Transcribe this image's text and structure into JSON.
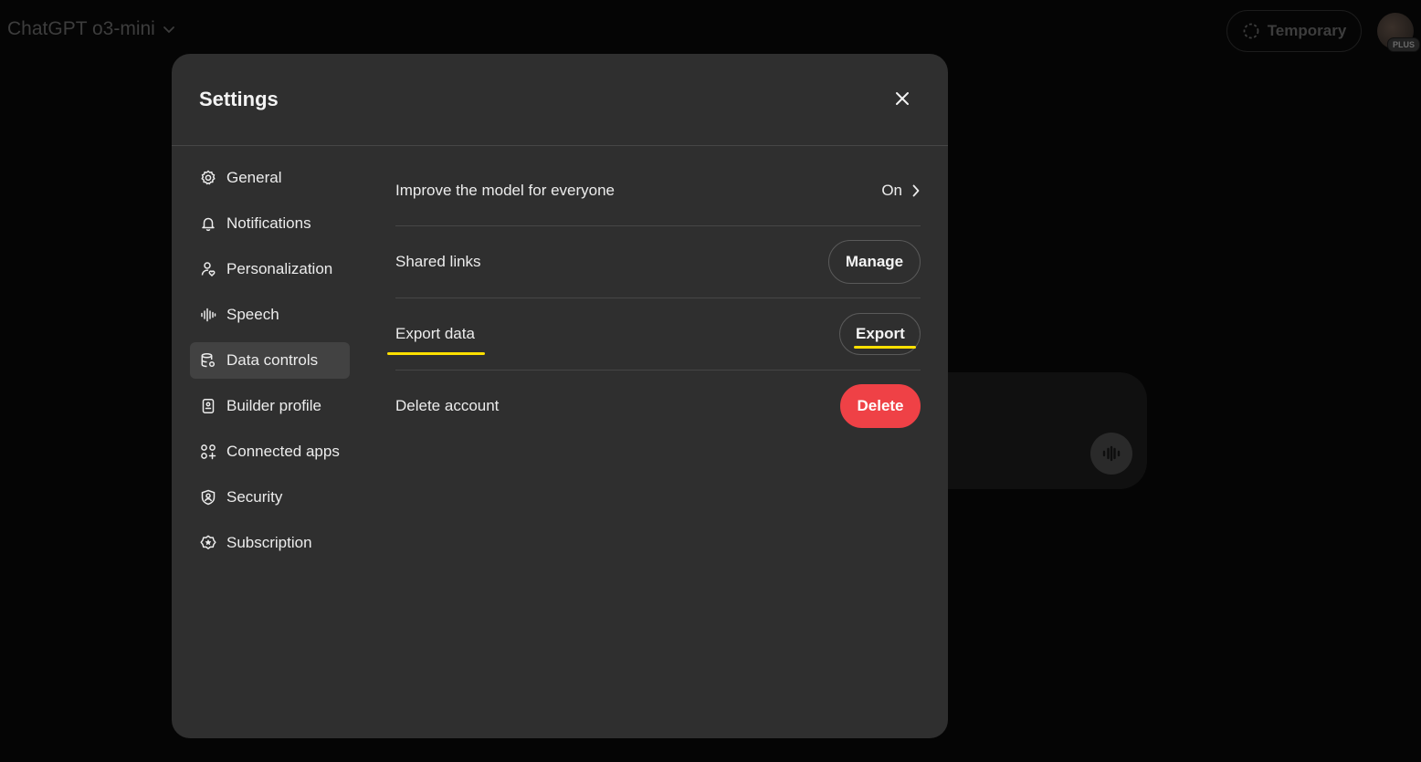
{
  "topbar": {
    "model_name": "ChatGPT o3-mini",
    "temporary_label": "Temporary",
    "plan_badge": "PLUS"
  },
  "modal": {
    "title": "Settings"
  },
  "sidebar": {
    "items": [
      {
        "label": "General",
        "icon": "gear-icon"
      },
      {
        "label": "Notifications",
        "icon": "bell-icon"
      },
      {
        "label": "Personalization",
        "icon": "person-heart-icon"
      },
      {
        "label": "Speech",
        "icon": "waveform-icon"
      },
      {
        "label": "Data controls",
        "icon": "database-gear-icon",
        "active": true
      },
      {
        "label": "Builder profile",
        "icon": "id-card-icon"
      },
      {
        "label": "Connected apps",
        "icon": "apps-grid-icon"
      },
      {
        "label": "Security",
        "icon": "shield-person-icon"
      },
      {
        "label": "Subscription",
        "icon": "badge-star-icon"
      }
    ]
  },
  "data_controls": {
    "improve_model": {
      "label": "Improve the model for everyone",
      "value": "On"
    },
    "shared_links": {
      "label": "Shared links",
      "button": "Manage"
    },
    "export_data": {
      "label": "Export data",
      "button": "Export"
    },
    "delete_account": {
      "label": "Delete account",
      "button": "Delete"
    }
  },
  "colors": {
    "modal_bg": "#2f2f2f",
    "active_item_bg": "#424242",
    "delete_red": "#ef4146",
    "annotation_yellow": "#ffe000"
  }
}
